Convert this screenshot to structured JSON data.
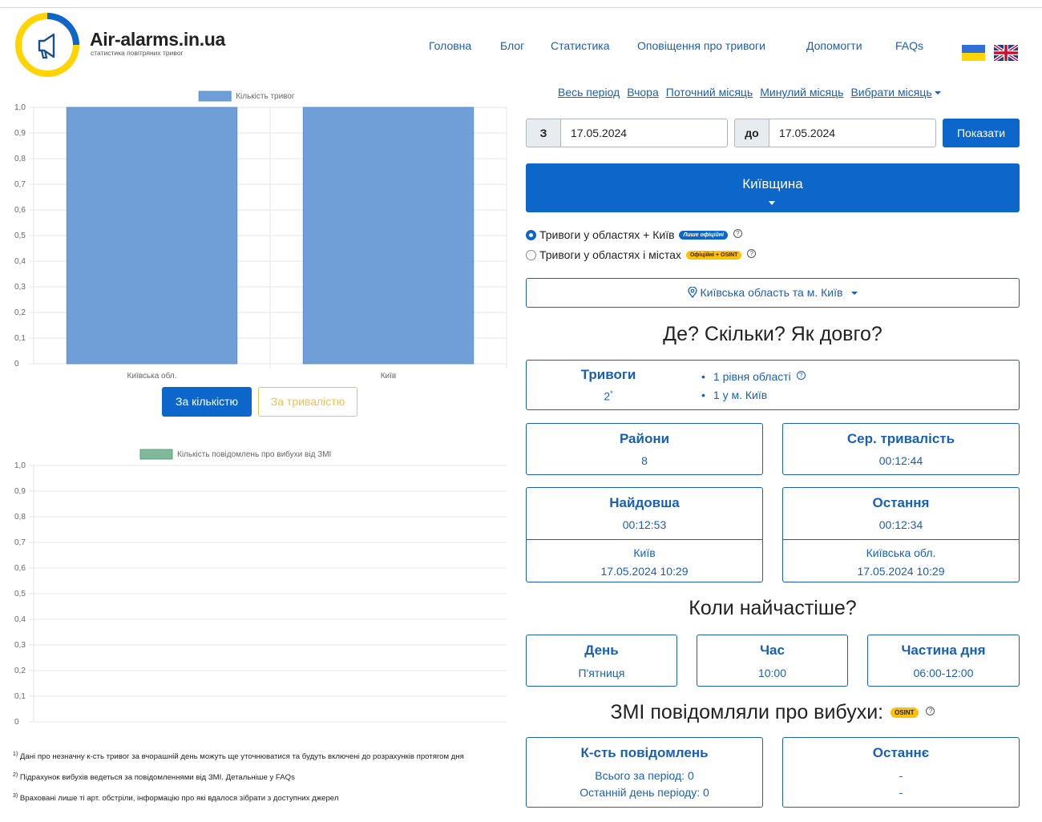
{
  "brand": {
    "name": "Air-alarms.in.ua",
    "tagline": "статистика повітряних тривог"
  },
  "nav": [
    "Головна",
    "Блог",
    "Статистика",
    "Оповіщення про тривоги",
    "Допомогти",
    "FAQs"
  ],
  "charts": {
    "alarms": {
      "legend": "Кількість тривог",
      "color": "#6f9fd6",
      "y_ticks": [
        "1,0",
        "0,9",
        "0,8",
        "0,7",
        "0,6",
        "0,5",
        "0,4",
        "0,3",
        "0,2",
        "0,1",
        "0"
      ]
    },
    "explosions": {
      "legend": "Кількість повідомлень про вибухи від ЗМІ",
      "color": "#7fb89a",
      "y_ticks": [
        "1,0",
        "0,9",
        "0,8",
        "0,7",
        "0,6",
        "0,5",
        "0,4",
        "0,3",
        "0,2",
        "0,1",
        "0"
      ]
    }
  },
  "chart_data": [
    {
      "type": "bar",
      "categories": [
        "Київська обл.",
        "Київ"
      ],
      "series": [
        {
          "name": "Кількість тривог",
          "values": [
            1,
            1
          ]
        }
      ],
      "ylim": [
        0,
        1.0
      ],
      "legend_position": "top"
    },
    {
      "type": "bar",
      "categories": [],
      "series": [
        {
          "name": "Кількість повідомлень про вибухи від ЗМІ",
          "values": []
        }
      ],
      "ylim": [
        0,
        1.0
      ],
      "legend_position": "top"
    }
  ],
  "chart_buttons": {
    "by_count": "За кількістю",
    "by_duration": "За тривалістю"
  },
  "footnotes": [
    {
      "num": "1)",
      "text": "Дані про незначну к-сть тривог за вчорашній день можуть ще уточнюватися та будуть включені до розрахунків протягом дня"
    },
    {
      "num": "2)",
      "text": "Підрахунок вибухів ведеться за повідомленнями від ЗМІ. Детальніше у FAQs"
    },
    {
      "num": "3)",
      "text": "Враховані лише ті арт. обстріли, інформацію про які вдалося зібрати з доступних джерел"
    }
  ],
  "periods": {
    "all": "Весь період",
    "yesterday": "Вчора",
    "current_month": "Поточний місяць",
    "last_month": "Минулий місяць",
    "pick_month": "Вибрати місяць"
  },
  "date_filter": {
    "from_label": "З",
    "from_value": "17.05.2024",
    "to_label": "до",
    "to_value": "17.05.2024",
    "submit": "Показати"
  },
  "region": "Київщина",
  "mode": {
    "option1": "Тривоги у областях + Київ",
    "option1_badge": "Лише офіційні",
    "option2": "Тривоги у областях і містах",
    "option2_badge": "Офіційні + OSINT"
  },
  "location": "Київська область та м. Київ",
  "sections": {
    "where": "Де? Скільки? Як довго?",
    "when": "Коли найчастіше?",
    "media": "ЗМІ повідомляли про вибухи:",
    "media_badge": "OSINT"
  },
  "alarms": {
    "title": "Тривоги",
    "value": "2",
    "marker": "*",
    "items": [
      "1 рівня області",
      "1 у м. Київ"
    ]
  },
  "districts": {
    "title": "Райони",
    "value": "8"
  },
  "avg_duration": {
    "title": "Сер. тривалість",
    "value": "00:12:44"
  },
  "longest": {
    "title": "Найдовша",
    "value": "00:12:53",
    "place": "Київ",
    "date": "17.05.2024 10:29"
  },
  "last": {
    "title": "Остання",
    "value": "00:12:34",
    "place": "Київська обл.",
    "date": "17.05.2024 10:29"
  },
  "day": {
    "title": "День",
    "value": "П'ятниця"
  },
  "hour": {
    "title": "Час",
    "value": "10:00"
  },
  "part_of_day": {
    "title": "Частина дня",
    "value": "06:00-12:00"
  },
  "media_count": {
    "title": "К-сть повідомлень",
    "total": "Всього за період: 0",
    "last_day": "Останній день періоду: 0"
  },
  "media_last": {
    "title": "Останнє",
    "line1": "-",
    "line2": "-"
  }
}
